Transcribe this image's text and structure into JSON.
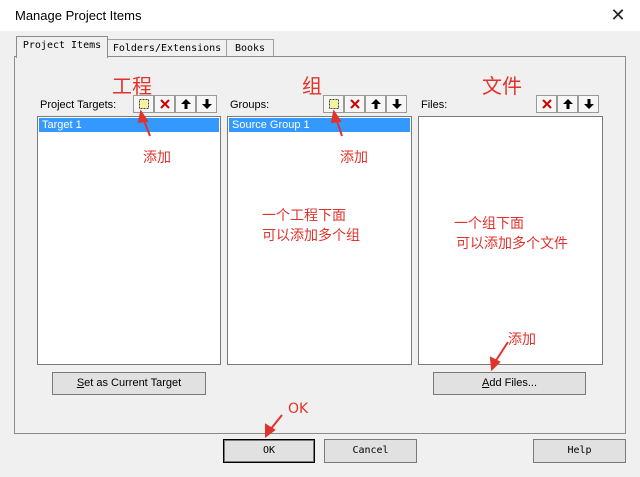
{
  "window": {
    "title": "Manage Project Items",
    "close_icon": "close-icon"
  },
  "tabs": [
    {
      "label": "Project Items",
      "active": true
    },
    {
      "label": "Folders/Extensions",
      "active": false
    },
    {
      "label": "Books",
      "active": false
    }
  ],
  "columns": {
    "targets": {
      "header": "Project Targets:",
      "items": [
        "Target 1"
      ],
      "button_label": "Set as Current Target",
      "button_ul": "S",
      "button_rest": "et as Current Target"
    },
    "groups": {
      "header": "Groups:",
      "items": [
        "Source Group 1"
      ]
    },
    "files": {
      "header": "Files:",
      "items": [],
      "button_label": "Add Files...",
      "button_ul": "A",
      "button_rest": "dd Files..."
    }
  },
  "footer": {
    "ok": "OK",
    "cancel": "Cancel",
    "help": "Help"
  },
  "annotations": {
    "col_target": "工程",
    "col_group": "组",
    "col_file": "文件",
    "add1": "添加",
    "add2": "添加",
    "add3": "添加",
    "group_note_1": "一个工程下面",
    "group_note_2": "可以添加多个组",
    "file_note_1": "一个组下面",
    "file_note_2": "可以添加多个文件",
    "ok_note": "OK"
  },
  "colors": {
    "selection": "#3399ff",
    "annotation": "#e0332b",
    "new_icon": "#e8e000",
    "delete_icon": "#cc0000"
  }
}
